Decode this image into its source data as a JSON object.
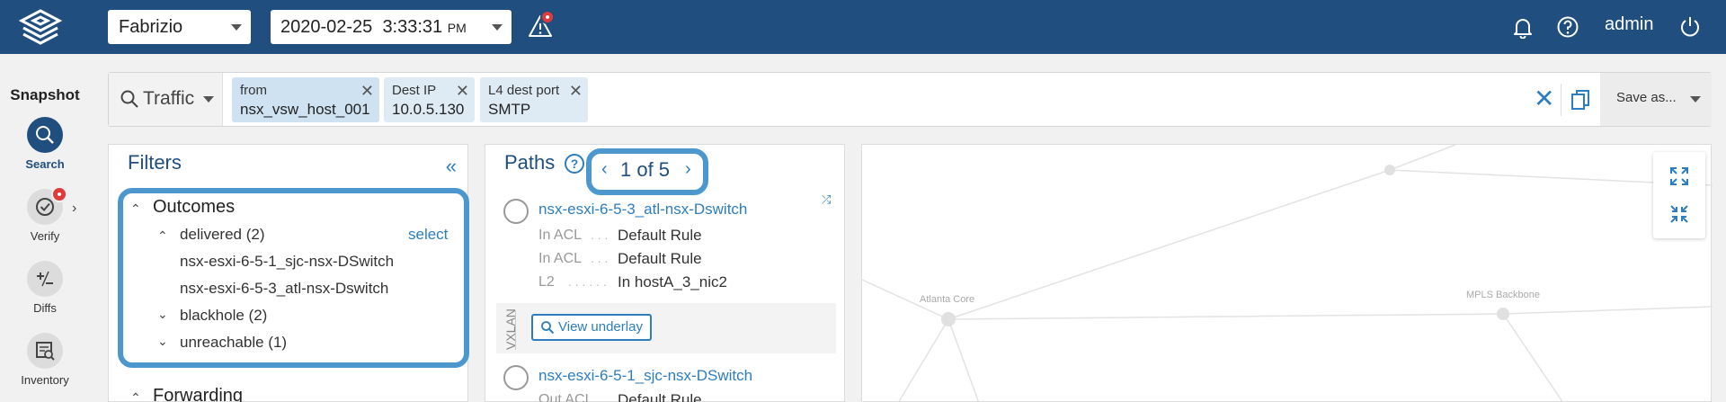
{
  "header": {
    "network": "Fabrizio",
    "date": "2020-02-25",
    "time": "3:33:31",
    "ampm": "PM",
    "user": "admin"
  },
  "left_nav": {
    "section": "Snapshot",
    "items": [
      {
        "label": "Search",
        "icon": "search-icon"
      },
      {
        "label": "Verify",
        "icon": "check-icon"
      },
      {
        "label": "Diffs",
        "icon": "plus-minus-icon"
      },
      {
        "label": "Inventory",
        "icon": "inventory-icon"
      }
    ]
  },
  "search": {
    "mode": "Traffic",
    "chips": [
      {
        "key": "from",
        "value": "nsx_vsw_host_001"
      },
      {
        "key": "Dest IP",
        "value": "10.0.5.130"
      },
      {
        "key": "L4 dest port",
        "value": "SMTP"
      }
    ],
    "save_label": "Save as..."
  },
  "filters": {
    "title": "Filters",
    "outcomes_label": "Outcomes",
    "delivered_label": "delivered (2)",
    "select_label": "select",
    "delivered_items": [
      "nsx-esxi-6-5-1_sjc-nsx-DSwitch",
      "nsx-esxi-6-5-3_atl-nsx-Dswitch"
    ],
    "blackhole_label": "blackhole (2)",
    "unreachable_label": "unreachable (1)",
    "forwarding_label": "Forwarding"
  },
  "paths": {
    "title": "Paths",
    "pager": "1 of 5",
    "hop1": {
      "name": "nsx-esxi-6-5-3_atl-nsx-Dswitch",
      "rows": [
        {
          "k": "In ACL",
          "v": "Default Rule"
        },
        {
          "k": "In ACL",
          "v": "Default Rule"
        },
        {
          "k": "L2",
          "v": "In hostA_3_nic2"
        }
      ]
    },
    "vxlan_label": "VXLAN",
    "underlay_label": "View underlay",
    "hop2": {
      "name": "nsx-esxi-6-5-1_sjc-nsx-DSwitch",
      "rows": [
        {
          "k": "Out ACL",
          "v": "Default Rule"
        }
      ]
    }
  },
  "map": {
    "labels": [
      "Atlanta Core",
      "MPLS Backbone"
    ]
  },
  "colors": {
    "header_bg": "#1f4e7f",
    "accent": "#2c7ec1",
    "highlight": "#4d97cf",
    "alert": "#e03a3a"
  }
}
